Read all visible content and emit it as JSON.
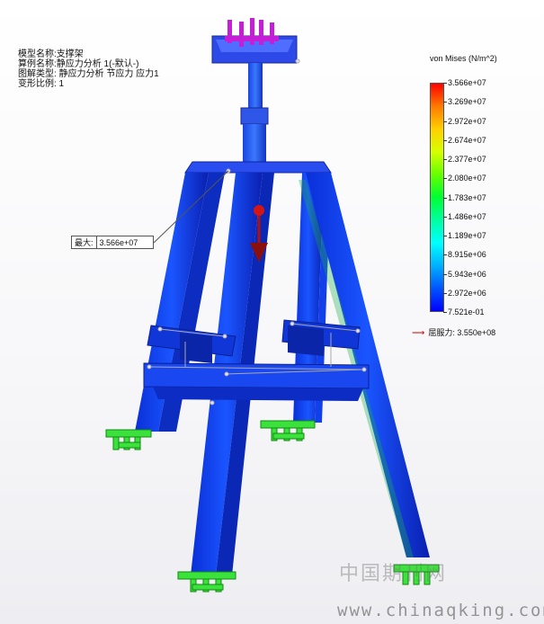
{
  "model_info": {
    "line1": "模型名称:支撑架",
    "line2": "算例名称:静应力分析 1(-默认-)",
    "line3": "图解类型: 静应力分析 节应力 应力1",
    "line4": "变形比例: 1"
  },
  "legend": {
    "title": "von Mises (N/m^2)",
    "ticks": [
      "3.566e+07",
      "3.269e+07",
      "2.972e+07",
      "2.674e+07",
      "2.377e+07",
      "2.080e+07",
      "1.783e+07",
      "1.486e+07",
      "1.189e+07",
      "8.915e+06",
      "5.943e+06",
      "2.972e+06",
      "7.521e-01"
    ],
    "colormap": [
      "#ff0000",
      "#ff7a00",
      "#ffd000",
      "#d6ff00",
      "#66ff00",
      "#00ff33",
      "#00ffa0",
      "#00ffff",
      "#00b0ff",
      "#0055ff",
      "#0000ff"
    ]
  },
  "yield": {
    "label": "屈服力: 3.550e+08"
  },
  "max_callout": {
    "label": "最大:",
    "value": "3.566e+07"
  },
  "watermark": {
    "cn": "中国期刊网",
    "url": "www.chinaqking.com"
  }
}
